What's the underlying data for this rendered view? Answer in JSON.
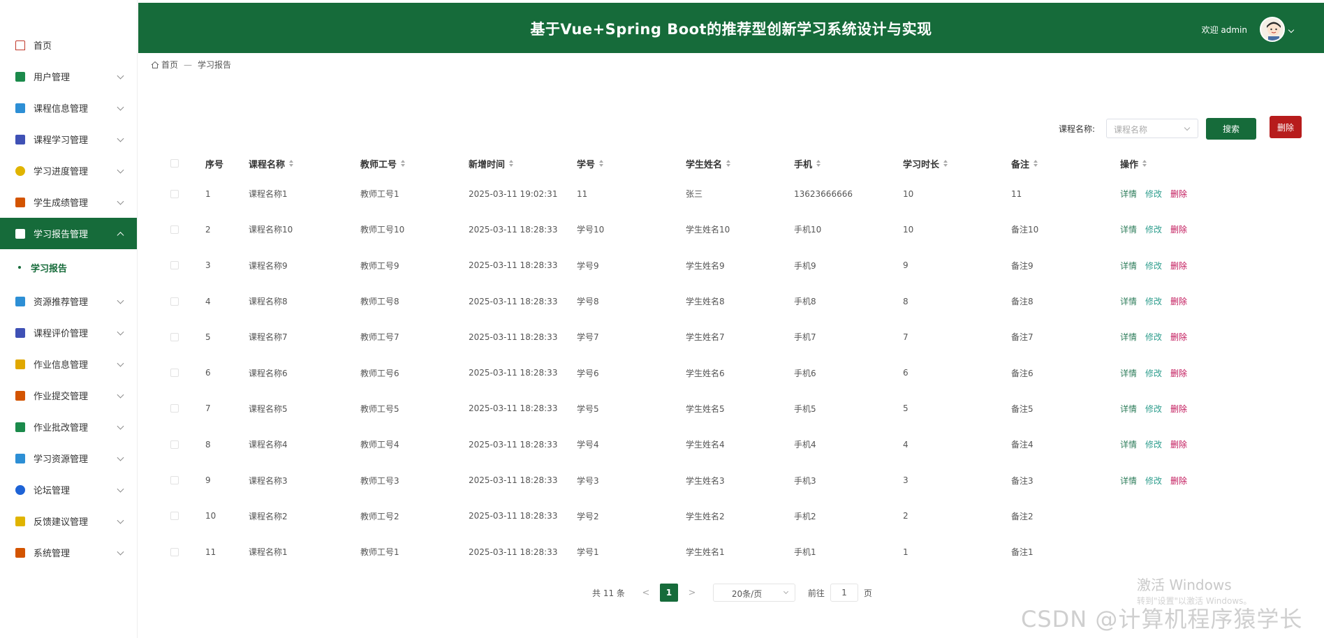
{
  "header": {
    "title": "基于Vue+Spring Boot的推荐型创新学习系统设计与实现",
    "welcome": "欢迎 admin"
  },
  "sidebar": {
    "items": [
      {
        "label": "首页",
        "icon": "home-icon",
        "color": "#c0392b"
      },
      {
        "label": "用户管理",
        "icon": "user-icon",
        "color": "#1b8a4b"
      },
      {
        "label": "课程信息管理",
        "icon": "layout-icon",
        "color": "#2d8fd5"
      },
      {
        "label": "课程学习管理",
        "icon": "chart-icon",
        "color": "#3f51b5"
      },
      {
        "label": "学习进度管理",
        "icon": "clock-icon",
        "color": "#e0b400"
      },
      {
        "label": "学生成绩管理",
        "icon": "book-icon",
        "color": "#d35400"
      },
      {
        "label": "学习报告管理",
        "icon": "report-icon",
        "color": "#ffffff"
      },
      {
        "label": "资源推荐管理",
        "icon": "briefcase-icon",
        "color": "#2d8fd5"
      },
      {
        "label": "课程评价管理",
        "icon": "image-icon",
        "color": "#3f51b5"
      },
      {
        "label": "作业信息管理",
        "icon": "robot-icon",
        "color": "#e0a800"
      },
      {
        "label": "作业提交管理",
        "icon": "file-icon",
        "color": "#d35400"
      },
      {
        "label": "作业批改管理",
        "icon": "basket-icon",
        "color": "#1b8a4b"
      },
      {
        "label": "学习资源管理",
        "icon": "reader-icon",
        "color": "#2d8fd5"
      },
      {
        "label": "论坛管理",
        "icon": "drop-icon",
        "color": "#1e63d6"
      },
      {
        "label": "反馈建议管理",
        "icon": "grid-icon",
        "color": "#e0b400"
      },
      {
        "label": "系统管理",
        "icon": "apps-icon",
        "color": "#d35400"
      }
    ],
    "submenu_label": "学习报告"
  },
  "breadcrumb": {
    "home": "首页",
    "separator": "—",
    "current": "学习报告"
  },
  "search": {
    "label": "课程名称:",
    "placeholder": "课程名称",
    "search_button": "搜索",
    "delete_button": "删除"
  },
  "table": {
    "headers": {
      "no": "序号",
      "course": "课程名称",
      "teacher": "教师工号",
      "time": "新增时间",
      "stuno": "学号",
      "stuname": "学生姓名",
      "phone": "手机",
      "duration": "学习时长",
      "note": "备注",
      "ops": "操作"
    },
    "ops": {
      "detail": "详情",
      "edit": "修改",
      "delete": "删除"
    },
    "rows": [
      {
        "no": "1",
        "course": "课程名称1",
        "teacher": "教师工号1",
        "time": "2025-03-11 19:02:31",
        "stuno": "11",
        "stuname": "张三",
        "phone": "13623666666",
        "duration": "10",
        "note": "11",
        "ops": true
      },
      {
        "no": "2",
        "course": "课程名称10",
        "teacher": "教师工号10",
        "time": "2025-03-11 18:28:33",
        "stuno": "学号10",
        "stuname": "学生姓名10",
        "phone": "手机10",
        "duration": "10",
        "note": "备注10",
        "ops": true
      },
      {
        "no": "3",
        "course": "课程名称9",
        "teacher": "教师工号9",
        "time": "2025-03-11 18:28:33",
        "stuno": "学号9",
        "stuname": "学生姓名9",
        "phone": "手机9",
        "duration": "9",
        "note": "备注9",
        "ops": true
      },
      {
        "no": "4",
        "course": "课程名称8",
        "teacher": "教师工号8",
        "time": "2025-03-11 18:28:33",
        "stuno": "学号8",
        "stuname": "学生姓名8",
        "phone": "手机8",
        "duration": "8",
        "note": "备注8",
        "ops": true
      },
      {
        "no": "5",
        "course": "课程名称7",
        "teacher": "教师工号7",
        "time": "2025-03-11 18:28:33",
        "stuno": "学号7",
        "stuname": "学生姓名7",
        "phone": "手机7",
        "duration": "7",
        "note": "备注7",
        "ops": true
      },
      {
        "no": "6",
        "course": "课程名称6",
        "teacher": "教师工号6",
        "time": "2025-03-11 18:28:33",
        "stuno": "学号6",
        "stuname": "学生姓名6",
        "phone": "手机6",
        "duration": "6",
        "note": "备注6",
        "ops": true
      },
      {
        "no": "7",
        "course": "课程名称5",
        "teacher": "教师工号5",
        "time": "2025-03-11 18:28:33",
        "stuno": "学号5",
        "stuname": "学生姓名5",
        "phone": "手机5",
        "duration": "5",
        "note": "备注5",
        "ops": true
      },
      {
        "no": "8",
        "course": "课程名称4",
        "teacher": "教师工号4",
        "time": "2025-03-11 18:28:33",
        "stuno": "学号4",
        "stuname": "学生姓名4",
        "phone": "手机4",
        "duration": "4",
        "note": "备注4",
        "ops": true
      },
      {
        "no": "9",
        "course": "课程名称3",
        "teacher": "教师工号3",
        "time": "2025-03-11 18:28:33",
        "stuno": "学号3",
        "stuname": "学生姓名3",
        "phone": "手机3",
        "duration": "3",
        "note": "备注3",
        "ops": true
      },
      {
        "no": "10",
        "course": "课程名称2",
        "teacher": "教师工号2",
        "time": "2025-03-11 18:28:33",
        "stuno": "学号2",
        "stuname": "学生姓名2",
        "phone": "手机2",
        "duration": "2",
        "note": "备注2",
        "ops": false
      },
      {
        "no": "11",
        "course": "课程名称1",
        "teacher": "教师工号1",
        "time": "2025-03-11 18:28:33",
        "stuno": "学号1",
        "stuname": "学生姓名1",
        "phone": "手机1",
        "duration": "1",
        "note": "备注1",
        "ops": false
      }
    ]
  },
  "pagination": {
    "total": "共 11 条",
    "prev": "<",
    "page": "1",
    "next": ">",
    "page_size": "20条/页",
    "goto_label": "前往",
    "goto_value": "1",
    "page_suffix": "页"
  },
  "watermark": {
    "activate": "激活 Windows",
    "activate_sub": "转到\"设置\"以激活 Windows。",
    "csdn": "CSDN @计算机程序猿学长"
  },
  "colors": {
    "primary": "#166b3a",
    "danger": "#b71c1c"
  }
}
